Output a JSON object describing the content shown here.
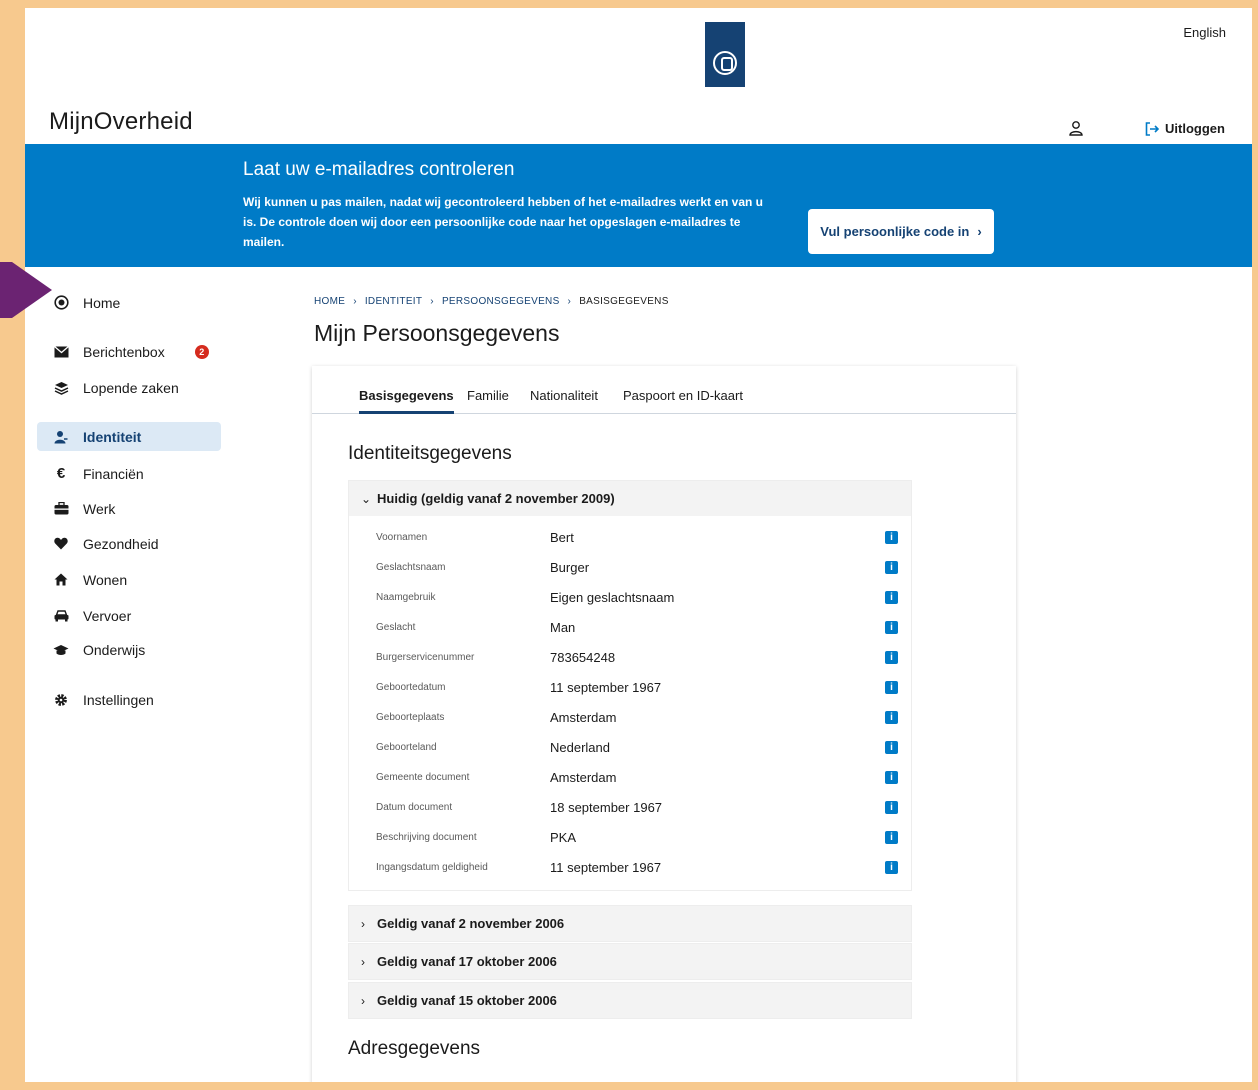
{
  "header": {
    "language": "English",
    "brand": "MijnOverheid",
    "logout": "Uitloggen"
  },
  "banner": {
    "title": "Laat uw e-mailadres controleren",
    "text": "Wij kunnen u pas mailen, nadat wij gecontroleerd hebben of het e-mailadres werkt en van u is. De controle doen wij door een persoonlijke code naar het opgeslagen e-mailadres te mailen.",
    "button": "Vul persoonlijke code in"
  },
  "sidebar": {
    "items": [
      {
        "label": "Home",
        "icon": "target-icon"
      },
      {
        "label": "Berichtenbox",
        "icon": "envelope-icon",
        "badge": "2"
      },
      {
        "label": "Lopende zaken",
        "icon": "layers-icon"
      },
      {
        "label": "Identiteit",
        "icon": "user-icon",
        "active": true
      },
      {
        "label": "Financiën",
        "icon": "euro-icon"
      },
      {
        "label": "Werk",
        "icon": "briefcase-icon"
      },
      {
        "label": "Gezondheid",
        "icon": "heart-icon"
      },
      {
        "label": "Wonen",
        "icon": "house-icon"
      },
      {
        "label": "Vervoer",
        "icon": "car-icon"
      },
      {
        "label": "Onderwijs",
        "icon": "graduation-cap-icon"
      },
      {
        "label": "Instellingen",
        "icon": "gear-icon"
      }
    ]
  },
  "breadcrumb": [
    "HOME",
    "IDENTITEIT",
    "PERSOONSGEGEVENS",
    "BASISGEGEVENS"
  ],
  "page_title": "Mijn Persoonsgegevens",
  "tabs": [
    "Basisgegevens",
    "Familie",
    "Nationaliteit",
    "Paspoort en ID-kaart"
  ],
  "section": {
    "title": "Identiteitsgegevens",
    "current": {
      "heading": "Huidig (geldig vanaf 2 november 2009)",
      "rows": [
        {
          "label": "Voornamen",
          "value": "Bert"
        },
        {
          "label": "Geslachtsnaam",
          "value": "Burger"
        },
        {
          "label": "Naamgebruik",
          "value": "Eigen geslachtsnaam"
        },
        {
          "label": "Geslacht",
          "value": "Man"
        },
        {
          "label": "Burgerservicenummer",
          "value": "783654248"
        },
        {
          "label": "Geboortedatum",
          "value": "11 september 1967"
        },
        {
          "label": "Geboorteplaats",
          "value": "Amsterdam"
        },
        {
          "label": "Geboorteland",
          "value": "Nederland"
        },
        {
          "label": "Gemeente document",
          "value": "Amsterdam"
        },
        {
          "label": "Datum document",
          "value": "18 september 1967"
        },
        {
          "label": "Beschrijving document",
          "value": "PKA"
        },
        {
          "label": "Ingangsdatum geldigheid",
          "value": "11 september 1967"
        }
      ]
    },
    "history": [
      "Geldig vanaf 2 november 2006",
      "Geldig vanaf 17 oktober 2006",
      "Geldig vanaf 15 oktober 2006"
    ]
  },
  "address_title": "Adresgegevens",
  "colors": {
    "banner": "#007bc7",
    "brand_dark": "#154273",
    "badge": "#d52b1e",
    "frame": "#f7c98e",
    "arrow": "#6b2372"
  }
}
